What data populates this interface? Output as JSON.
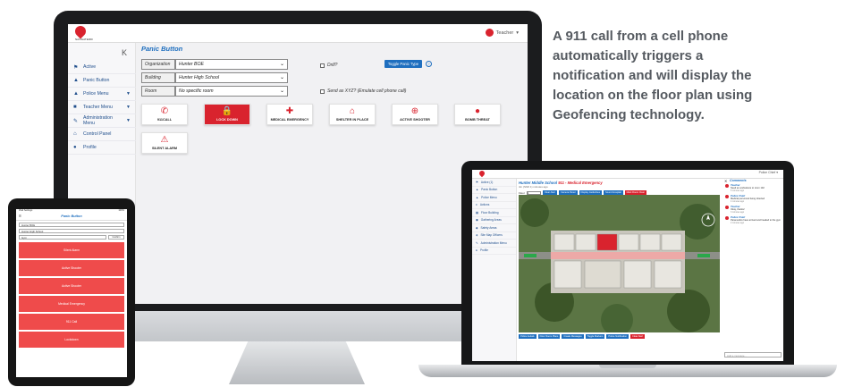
{
  "promo": {
    "line1": "A 911 call from a cell phone",
    "line2": "automatically triggers a",
    "line3": "notification and will display the",
    "line4": "location on the floor plan using",
    "line5": "Geofencing technology."
  },
  "desktop_app": {
    "logo_caption": "NAVIGATE360",
    "user": "Teacher",
    "page_title": "Panic Button",
    "collapse_glyph": "K",
    "sidebar": [
      {
        "label": "Active",
        "icon": "flag-icon"
      },
      {
        "label": "Panic Button",
        "icon": "warning-icon"
      },
      {
        "label": "Police Menu",
        "icon": "police-icon",
        "caret": true
      },
      {
        "label": "Teacher Menu",
        "icon": "car-icon",
        "caret": true
      },
      {
        "label": "Administration Menu",
        "icon": "wrench-icon",
        "caret": true
      },
      {
        "label": "Control Panel",
        "icon": "home-icon"
      },
      {
        "label": "Profile",
        "icon": "user-icon"
      }
    ],
    "form": {
      "organization_label": "Organization",
      "organization_value": "Hunter BOE",
      "building_label": "Building",
      "building_value": "Hunter High School",
      "room_label": "Room",
      "room_value": "No specific room"
    },
    "drill_label": "Drill?",
    "toggle_button": "Toggle Panic Type",
    "send_as_label": "Send as XYZ? (Emulate cell phone call)",
    "tiles": [
      {
        "label": "911CALL",
        "icon": "phone-icon",
        "glyph": "✆"
      },
      {
        "label": "LOCK DOWN",
        "icon": "lock-icon",
        "glyph": "🔒",
        "active": true
      },
      {
        "label": "MEDICAL EMERGENCY",
        "icon": "medical-icon",
        "glyph": "✚"
      },
      {
        "label": "SHELTER IN PLACE",
        "icon": "house-icon",
        "glyph": "⌂"
      },
      {
        "label": "ACTIVE SHOOTER",
        "icon": "crosshair-icon",
        "glyph": "⊕"
      },
      {
        "label": "BOMB THREAT",
        "icon": "bomb-icon",
        "glyph": "●"
      },
      {
        "label": "SILENT ALARM",
        "icon": "alarm-icon",
        "glyph": "⚠"
      }
    ]
  },
  "laptop_app": {
    "user": "Police Chief",
    "title": "Hunter Middle School",
    "title_tag": "911 - Medical Emergency",
    "subtitle": "4m (Shift 1) minutes ago",
    "floor_label": "Floor",
    "floor_value": "1",
    "top_buttons": [
      "Clear Alert",
      "Camera Panel",
      "Display Guidelines",
      "Sound Hospital",
      "Mark Room Clear"
    ],
    "sidebar": [
      "Active (1)",
      "Panic Button",
      "Police Menu",
      "Actions",
      "Floor Building",
      "Gathering Areas",
      "Safety Areas",
      "Site Map Officers",
      "Administration Menu",
      "Profile"
    ],
    "bottom_buttons": [
      "Police Aerials",
      "Floor Room Plans",
      "Create Messages",
      "Toggle Markers",
      "Police Notification",
      "Clear Alert"
    ],
    "comments_title": "Comments",
    "comments": [
      {
        "name": "Teacher",
        "text": "Need an ambulance to room 102",
        "time": "5 minutes ago"
      },
      {
        "name": "Police Chief",
        "text": "Medical personnel being directed",
        "time": "4 minutes ago"
      },
      {
        "name": "Teacher",
        "text": "Okay, thanks!",
        "time": "3 minutes ago"
      },
      {
        "name": "Police Chief",
        "text": "Paramedics have arrived and headed to the gym",
        "time": "2 minutes ago"
      }
    ],
    "comment_placeholder": "Add a message..."
  },
  "tablet_app": {
    "status_left": "iPad Settings",
    "status_right": "100%",
    "title": "Panic Button",
    "org": "Hunter BOE",
    "building": "Hunter High School",
    "room": "Gym",
    "confirm": "Confirm",
    "buttons": [
      "Silent Alarm",
      "Active Shooter",
      "Active Shooter",
      "Medical Emergency",
      "911 Call",
      "Lockdown"
    ]
  },
  "colors": {
    "accent": "#1f6fbf",
    "alert": "#d9232e",
    "tablet_button": "#ef4b4b"
  }
}
